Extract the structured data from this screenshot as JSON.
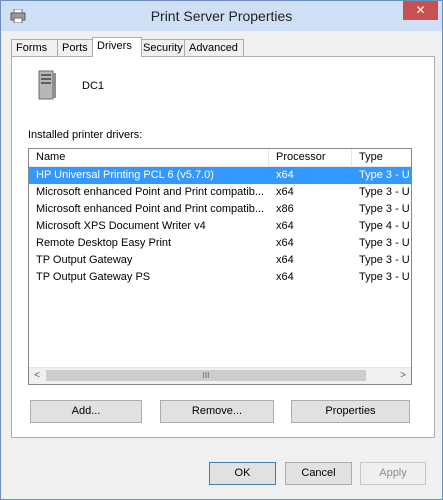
{
  "window": {
    "title": "Print Server Properties",
    "close_glyph": "✕"
  },
  "tabs": [
    {
      "label": "Forms"
    },
    {
      "label": "Ports"
    },
    {
      "label": "Drivers"
    },
    {
      "label": "Security"
    },
    {
      "label": "Advanced"
    }
  ],
  "server": {
    "name": "DC1"
  },
  "drivers": {
    "section_label": "Installed printer drivers:",
    "columns": {
      "name": "Name",
      "processor": "Processor",
      "type": "Type"
    },
    "rows": [
      {
        "name": "HP Universal Printing PCL 6 (v5.7.0)",
        "processor": "x64",
        "type": "Type 3 - U"
      },
      {
        "name": "Microsoft enhanced Point and Print compatib...",
        "processor": "x64",
        "type": "Type 3 - U"
      },
      {
        "name": "Microsoft enhanced Point and Print compatib...",
        "processor": "x86",
        "type": "Type 3 - U"
      },
      {
        "name": "Microsoft XPS Document Writer v4",
        "processor": "x64",
        "type": "Type 4 - U"
      },
      {
        "name": "Remote Desktop Easy Print",
        "processor": "x64",
        "type": "Type 3 - U"
      },
      {
        "name": "TP Output Gateway",
        "processor": "x64",
        "type": "Type 3 - U"
      },
      {
        "name": "TP Output Gateway PS",
        "processor": "x64",
        "type": "Type 3 - U"
      }
    ],
    "scroll_left": "<",
    "scroll_right": ">",
    "scroll_grip": "III"
  },
  "buttons": {
    "add": "Add...",
    "remove": "Remove...",
    "properties": "Properties",
    "ok": "OK",
    "cancel": "Cancel",
    "apply": "Apply"
  }
}
